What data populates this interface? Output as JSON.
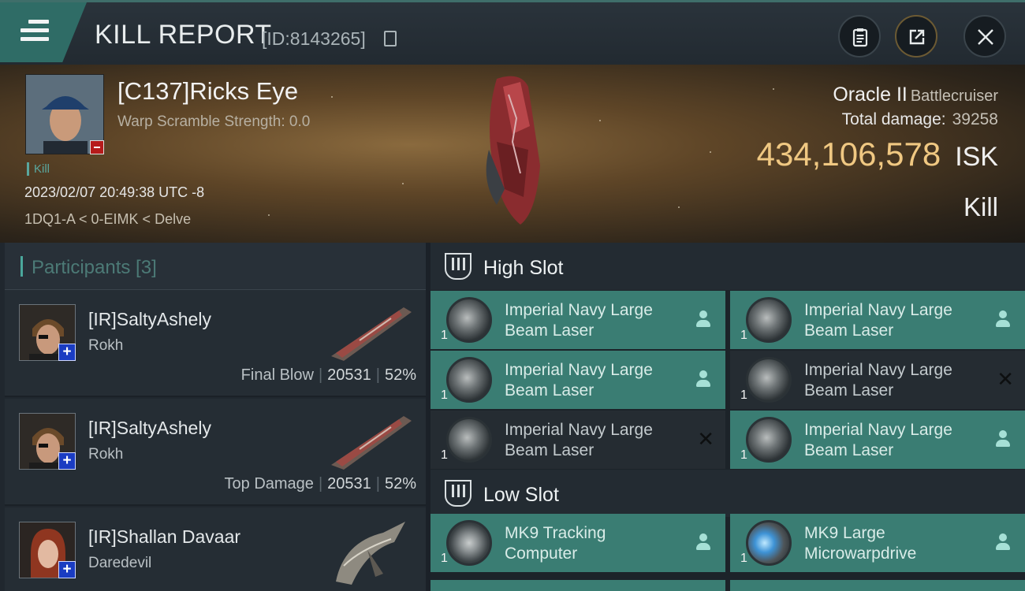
{
  "header": {
    "title": "KILL REPORT",
    "report_id": "[ID:8143265]"
  },
  "victim": {
    "name": "[C137]Ricks Eye",
    "warp_scramble": "Warp Scramble Strength: 0.0",
    "kill_tag": "Kill",
    "datetime": "2023/02/07 20:49:38 UTC -8",
    "location": "1DQ1-A < 0-EIMK < Delve",
    "ship_name": "Oracle II",
    "ship_class": "Battlecruiser",
    "total_damage_label": "Total damage:",
    "total_damage": "39258",
    "isk_value": "434,106,578",
    "isk_unit": "ISK",
    "result": "Kill"
  },
  "participants": {
    "header": "Participants [3]",
    "items": [
      {
        "name": "[IR]SaltyAshely",
        "ship": "Rokh",
        "label": "Final Blow",
        "damage": "20531",
        "percent": "52%"
      },
      {
        "name": "[IR]SaltyAshely",
        "ship": "Rokh",
        "label": "Top Damage",
        "damage": "20531",
        "percent": "52%"
      },
      {
        "name": "[IR]Shallan Davaar",
        "ship": "Daredevil",
        "label": "",
        "damage": "",
        "percent": ""
      }
    ]
  },
  "fitting": {
    "high_slot_title": "High Slot",
    "low_slot_title": "Low Slot",
    "high_slot": [
      {
        "name_line1": "Imperial Navy Large",
        "name_line2": "Beam Laser",
        "qty": "1",
        "state": "dropped"
      },
      {
        "name_line1": "Imperial Navy Large",
        "name_line2": "Beam Laser",
        "qty": "1",
        "state": "dropped"
      },
      {
        "name_line1": "Imperial Navy Large",
        "name_line2": "Beam Laser",
        "qty": "1",
        "state": "dropped"
      },
      {
        "name_line1": "Imperial Navy Large",
        "name_line2": "Beam Laser",
        "qty": "1",
        "state": "destroyed"
      },
      {
        "name_line1": "Imperial Navy Large",
        "name_line2": "Beam Laser",
        "qty": "1",
        "state": "destroyed"
      },
      {
        "name_line1": "Imperial Navy Large",
        "name_line2": "Beam Laser",
        "qty": "1",
        "state": "dropped"
      }
    ],
    "low_slot": [
      {
        "name_line1": "MK9 Tracking",
        "name_line2": "Computer",
        "qty": "1",
        "state": "dropped"
      },
      {
        "name_line1": "MK9 Large",
        "name_line2": "Microwarpdrive",
        "qty": "1",
        "state": "dropped"
      }
    ]
  },
  "colors": {
    "accent_teal": "#3a7d73",
    "isk_gold": "#f0c882",
    "badge_red": "#b61b1b",
    "badge_blue": "#1a3cc2"
  },
  "icons": [
    "menu-icon",
    "copy-icon",
    "clipboard-icon",
    "share-icon",
    "close-icon",
    "slot-icon",
    "person-icon",
    "destroyed-x-icon",
    "plus-icon",
    "minus-icon"
  ]
}
